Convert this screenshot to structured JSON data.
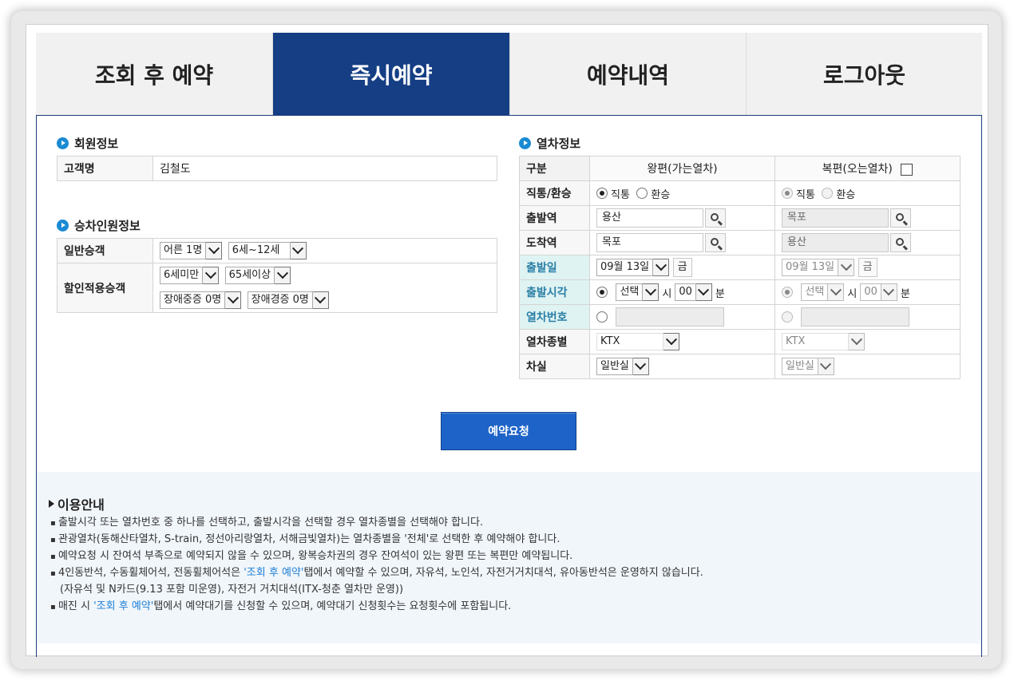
{
  "tabs": [
    {
      "label": "조회 후 예약",
      "active": false
    },
    {
      "label": "즉시예약",
      "active": true
    },
    {
      "label": "예약내역",
      "active": false
    },
    {
      "label": "로그아웃",
      "active": false
    }
  ],
  "member": {
    "title": "회원정보",
    "name_label": "고객명",
    "name_value": "김철도"
  },
  "passengers": {
    "title": "승차인원정보",
    "general_label": "일반승객",
    "adult": "어른 1명",
    "child": "6세~12세",
    "discount_label": "할인적용승객",
    "under6": "6세미만",
    "senior": "65세이상",
    "disabled_severe": "장애중증 0명",
    "disabled_mild": "장애경증 0명"
  },
  "train": {
    "title": "열차정보",
    "col_label": "구분",
    "outbound_header": "왕편(가는열차)",
    "return_header": "복편(오는열차)",
    "rows": {
      "type_label": "직통/환승",
      "direct": "직통",
      "transfer": "환승",
      "departure_label": "출발역",
      "arrival_label": "도착역",
      "date_label": "출발일",
      "time_label": "출발시각",
      "train_no_label": "열차번호",
      "train_kind_label": "열차종별",
      "car_label": "차실"
    },
    "outbound": {
      "departure": "용산",
      "arrival": "목포",
      "date": "09월 13일",
      "day": "금",
      "hour": "선택",
      "hour_unit": "시",
      "minute": "00",
      "minute_unit": "분",
      "train_kind": "KTX",
      "car": "일반실"
    },
    "return": {
      "departure": "목포",
      "arrival": "용산",
      "date": "09월 13일",
      "day": "금",
      "hour": "선택",
      "hour_unit": "시",
      "minute": "00",
      "minute_unit": "분",
      "train_kind": "KTX",
      "car": "일반실"
    }
  },
  "submit_label": "예약요청",
  "guide": {
    "title": "이용안내",
    "line1": "출발시각 또는 열차번호 중 하나를 선택하고, 출발시각을 선택할 경우 열차종별을 선택해야 합니다.",
    "line2": "관광열차(동해산타열차, S-train, 정선아리랑열차, 서해금빛열차)는 열차종별을 '전체'로 선택한 후 예약해야 합니다.",
    "line3": "예약요청 시 잔여석 부족으로 예약되지 않을 수 있으며, 왕복승차권의 경우 잔여석이 있는 왕편 또는 복편만 예약됩니다.",
    "line4_pre": "4인동반석, 수동휠체어석, 전동휠체어석은 ",
    "line4_link": "'조회 후 예약'",
    "line4_post": "탭에서 예약할 수 있으며, 자유석, 노인석, 자전거거치대석, 유아동반석은 운영하지 않습니다.",
    "line5": "(자유석 및 N카드(9.13 포함 미운영), 자전거 거치대석(ITX-청춘 열차만 운영))",
    "line6_pre": "매진 시 ",
    "line6_link": "'조회 후 예약'",
    "line6_post": "탭에서 예약대기를 신청할 수 있으며, 예약대기 신청횟수는 요청횟수에 포함됩니다."
  }
}
